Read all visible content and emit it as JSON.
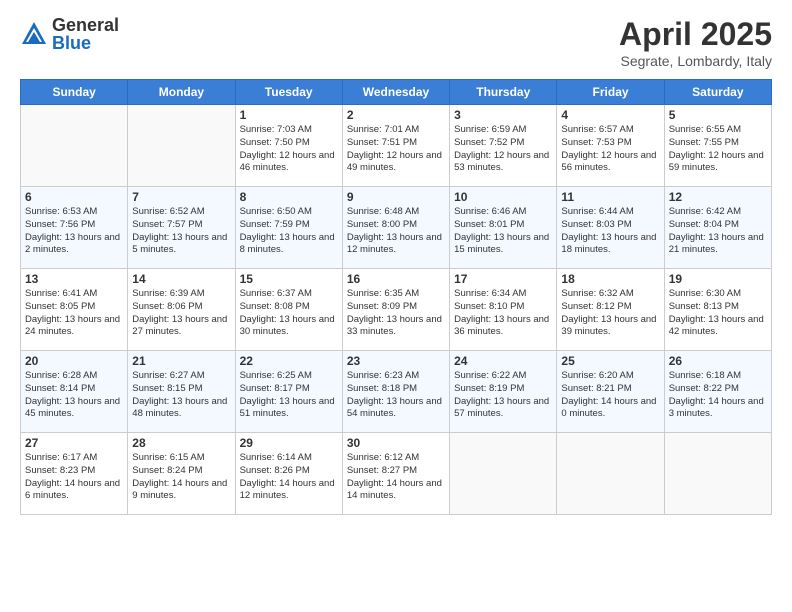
{
  "logo": {
    "general": "General",
    "blue": "Blue"
  },
  "title": "April 2025",
  "subtitle": "Segrate, Lombardy, Italy",
  "weekdays": [
    "Sunday",
    "Monday",
    "Tuesday",
    "Wednesday",
    "Thursday",
    "Friday",
    "Saturday"
  ],
  "weeks": [
    [
      {
        "day": "",
        "info": ""
      },
      {
        "day": "",
        "info": ""
      },
      {
        "day": "1",
        "info": "Sunrise: 7:03 AM\nSunset: 7:50 PM\nDaylight: 12 hours\nand 46 minutes."
      },
      {
        "day": "2",
        "info": "Sunrise: 7:01 AM\nSunset: 7:51 PM\nDaylight: 12 hours\nand 49 minutes."
      },
      {
        "day": "3",
        "info": "Sunrise: 6:59 AM\nSunset: 7:52 PM\nDaylight: 12 hours\nand 53 minutes."
      },
      {
        "day": "4",
        "info": "Sunrise: 6:57 AM\nSunset: 7:53 PM\nDaylight: 12 hours\nand 56 minutes."
      },
      {
        "day": "5",
        "info": "Sunrise: 6:55 AM\nSunset: 7:55 PM\nDaylight: 12 hours\nand 59 minutes."
      }
    ],
    [
      {
        "day": "6",
        "info": "Sunrise: 6:53 AM\nSunset: 7:56 PM\nDaylight: 13 hours\nand 2 minutes."
      },
      {
        "day": "7",
        "info": "Sunrise: 6:52 AM\nSunset: 7:57 PM\nDaylight: 13 hours\nand 5 minutes."
      },
      {
        "day": "8",
        "info": "Sunrise: 6:50 AM\nSunset: 7:59 PM\nDaylight: 13 hours\nand 8 minutes."
      },
      {
        "day": "9",
        "info": "Sunrise: 6:48 AM\nSunset: 8:00 PM\nDaylight: 13 hours\nand 12 minutes."
      },
      {
        "day": "10",
        "info": "Sunrise: 6:46 AM\nSunset: 8:01 PM\nDaylight: 13 hours\nand 15 minutes."
      },
      {
        "day": "11",
        "info": "Sunrise: 6:44 AM\nSunset: 8:03 PM\nDaylight: 13 hours\nand 18 minutes."
      },
      {
        "day": "12",
        "info": "Sunrise: 6:42 AM\nSunset: 8:04 PM\nDaylight: 13 hours\nand 21 minutes."
      }
    ],
    [
      {
        "day": "13",
        "info": "Sunrise: 6:41 AM\nSunset: 8:05 PM\nDaylight: 13 hours\nand 24 minutes."
      },
      {
        "day": "14",
        "info": "Sunrise: 6:39 AM\nSunset: 8:06 PM\nDaylight: 13 hours\nand 27 minutes."
      },
      {
        "day": "15",
        "info": "Sunrise: 6:37 AM\nSunset: 8:08 PM\nDaylight: 13 hours\nand 30 minutes."
      },
      {
        "day": "16",
        "info": "Sunrise: 6:35 AM\nSunset: 8:09 PM\nDaylight: 13 hours\nand 33 minutes."
      },
      {
        "day": "17",
        "info": "Sunrise: 6:34 AM\nSunset: 8:10 PM\nDaylight: 13 hours\nand 36 minutes."
      },
      {
        "day": "18",
        "info": "Sunrise: 6:32 AM\nSunset: 8:12 PM\nDaylight: 13 hours\nand 39 minutes."
      },
      {
        "day": "19",
        "info": "Sunrise: 6:30 AM\nSunset: 8:13 PM\nDaylight: 13 hours\nand 42 minutes."
      }
    ],
    [
      {
        "day": "20",
        "info": "Sunrise: 6:28 AM\nSunset: 8:14 PM\nDaylight: 13 hours\nand 45 minutes."
      },
      {
        "day": "21",
        "info": "Sunrise: 6:27 AM\nSunset: 8:15 PM\nDaylight: 13 hours\nand 48 minutes."
      },
      {
        "day": "22",
        "info": "Sunrise: 6:25 AM\nSunset: 8:17 PM\nDaylight: 13 hours\nand 51 minutes."
      },
      {
        "day": "23",
        "info": "Sunrise: 6:23 AM\nSunset: 8:18 PM\nDaylight: 13 hours\nand 54 minutes."
      },
      {
        "day": "24",
        "info": "Sunrise: 6:22 AM\nSunset: 8:19 PM\nDaylight: 13 hours\nand 57 minutes."
      },
      {
        "day": "25",
        "info": "Sunrise: 6:20 AM\nSunset: 8:21 PM\nDaylight: 14 hours\nand 0 minutes."
      },
      {
        "day": "26",
        "info": "Sunrise: 6:18 AM\nSunset: 8:22 PM\nDaylight: 14 hours\nand 3 minutes."
      }
    ],
    [
      {
        "day": "27",
        "info": "Sunrise: 6:17 AM\nSunset: 8:23 PM\nDaylight: 14 hours\nand 6 minutes."
      },
      {
        "day": "28",
        "info": "Sunrise: 6:15 AM\nSunset: 8:24 PM\nDaylight: 14 hours\nand 9 minutes."
      },
      {
        "day": "29",
        "info": "Sunrise: 6:14 AM\nSunset: 8:26 PM\nDaylight: 14 hours\nand 12 minutes."
      },
      {
        "day": "30",
        "info": "Sunrise: 6:12 AM\nSunset: 8:27 PM\nDaylight: 14 hours\nand 14 minutes."
      },
      {
        "day": "",
        "info": ""
      },
      {
        "day": "",
        "info": ""
      },
      {
        "day": "",
        "info": ""
      }
    ]
  ]
}
